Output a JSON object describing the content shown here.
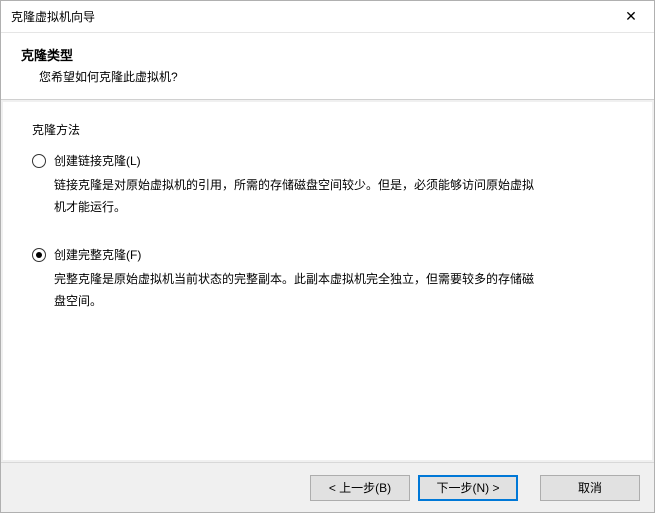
{
  "titlebar": {
    "title": "克隆虚拟机向导",
    "close_glyph": "✕"
  },
  "header": {
    "heading": "克隆类型",
    "subheading": "您希望如何克隆此虚拟机?"
  },
  "content": {
    "section_label": "克隆方法",
    "options": [
      {
        "label": "创建链接克隆(L)",
        "description": "链接克隆是对原始虚拟机的引用，所需的存储磁盘空间较少。但是，必须能够访问原始虚拟机才能运行。",
        "selected": false
      },
      {
        "label": "创建完整克隆(F)",
        "description": "完整克隆是原始虚拟机当前状态的完整副本。此副本虚拟机完全独立，但需要较多的存储磁盘空间。",
        "selected": true
      }
    ]
  },
  "footer": {
    "back": "< 上一步(B)",
    "next": "下一步(N) >",
    "cancel": "取消"
  }
}
